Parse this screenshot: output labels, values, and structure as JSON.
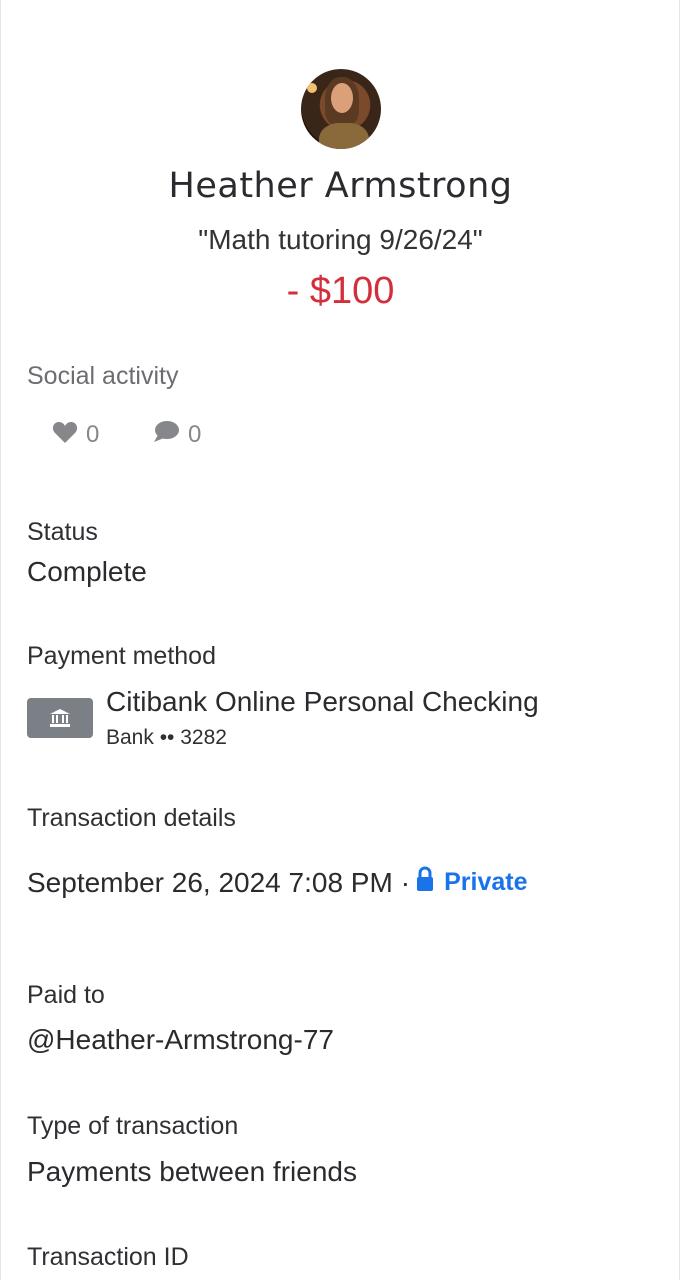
{
  "profile": {
    "name": "Heather Armstrong",
    "memo": "\"Math tutoring 9/26/24\"",
    "amount": "- $100"
  },
  "social": {
    "heading": "Social activity",
    "likes": "0",
    "comments": "0"
  },
  "status": {
    "label": "Status",
    "value": "Complete"
  },
  "payment_method": {
    "label": "Payment method",
    "bank_name": "Citibank Online Personal Checking",
    "account": "Bank •• 3282"
  },
  "transaction_details": {
    "label": "Transaction details",
    "datetime": "September 26, 2024 7:08 PM",
    "separator": "·",
    "privacy": "Private"
  },
  "paid_to": {
    "label": "Paid to",
    "value": "@Heather-Armstrong-77"
  },
  "type": {
    "label": "Type of transaction",
    "value": "Payments between friends"
  },
  "transaction_id": {
    "label": "Transaction ID"
  },
  "colors": {
    "amount": "#d32f3a",
    "private_link": "#1a73e8",
    "bank_icon_bg": "#7b7f86"
  }
}
